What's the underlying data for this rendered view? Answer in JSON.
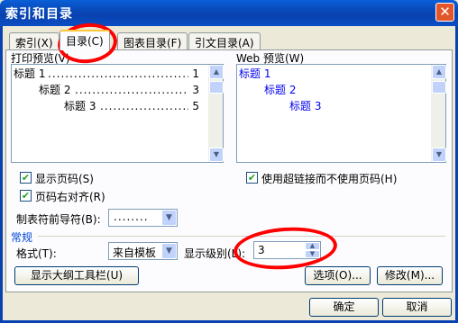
{
  "window": {
    "title": "索引和目录",
    "close_glyph": "✕"
  },
  "tabs": [
    {
      "label": "索引(X)"
    },
    {
      "label": "目录(C)"
    },
    {
      "label": "图表目录(F)"
    },
    {
      "label": "引文目录(A)"
    }
  ],
  "print_preview": {
    "label": "打印预览(V)",
    "entries": [
      {
        "text": "标题 1",
        "page": "1"
      },
      {
        "text": "标题 2",
        "page": "3"
      },
      {
        "text": "标题 3",
        "page": "5"
      }
    ]
  },
  "web_preview": {
    "label": "Web 预览(W)",
    "entries": [
      "标题 1",
      "标题 2",
      "标题 3"
    ]
  },
  "options": {
    "show_page_numbers": {
      "label": "显示页码(S)",
      "checked": true
    },
    "right_align": {
      "label": "页码右对齐(R)",
      "checked": true
    },
    "hyperlinks": {
      "label": "使用超链接而不使用页码(H)",
      "checked": true
    },
    "tab_leader": {
      "label": "制表符前导符(B):",
      "value": "........"
    }
  },
  "general": {
    "label": "常规",
    "format_label": "格式(T):",
    "format_value": "来自模板",
    "levels_label": "显示级别(L):",
    "levels_value": "3"
  },
  "buttons": {
    "outline": "显示大纲工具栏(U)",
    "options": "选项(O)...",
    "modify": "修改(M)...",
    "ok": "确定",
    "cancel": "取消"
  },
  "icons": {
    "up": "▲",
    "down": "▼",
    "check": "✔"
  }
}
